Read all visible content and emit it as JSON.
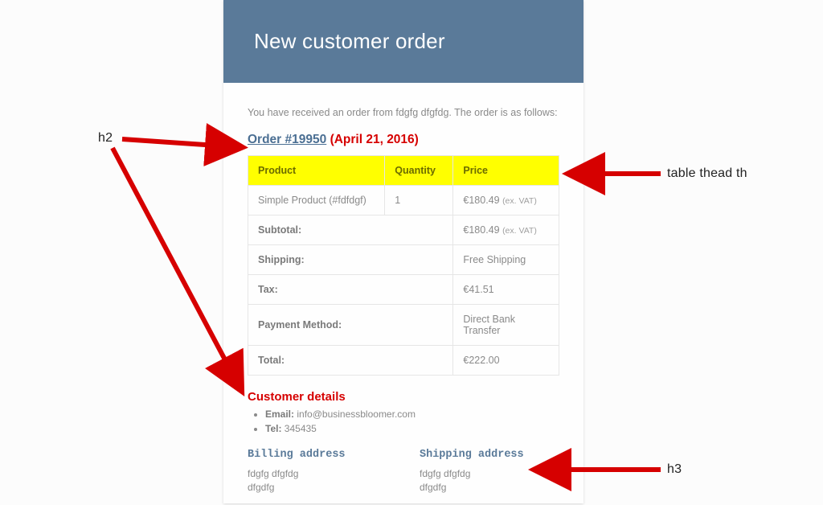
{
  "header": {
    "title": "New customer order"
  },
  "intro": "You have received an order from fdgfg dfgfdg. The order is as follows:",
  "order_heading": {
    "link": "Order #19950",
    "date": "(April 21, 2016)"
  },
  "table": {
    "headers": {
      "product": "Product",
      "quantity": "Quantity",
      "price": "Price"
    },
    "rows": [
      {
        "product": "Simple Product (#fdfdgf)",
        "quantity": "1",
        "price": "€180.49",
        "price_suffix": "(ex. VAT)"
      }
    ],
    "totals": [
      {
        "label": "Subtotal:",
        "value": "€180.49",
        "suffix": "(ex. VAT)"
      },
      {
        "label": "Shipping:",
        "value": "Free Shipping"
      },
      {
        "label": "Tax:",
        "value": "€41.51"
      },
      {
        "label": "Payment Method:",
        "value": "Direct Bank Transfer"
      },
      {
        "label": "Total:",
        "value": "€222.00"
      }
    ]
  },
  "customer_heading": "Customer details",
  "customer": {
    "email_label": "Email:",
    "email_value": "info@businessbloomer.com",
    "tel_label": "Tel:",
    "tel_value": "345435"
  },
  "addresses": {
    "billing_heading": "Billing address",
    "shipping_heading": "Shipping address",
    "billing": [
      "fdgfg dfgfdg",
      "dfgdfg"
    ],
    "shipping": [
      "fdgfg dfgfdg",
      "dfgdfg"
    ]
  },
  "annotations": {
    "h2": "h2",
    "thead": "table thead th",
    "h3": "h3"
  }
}
